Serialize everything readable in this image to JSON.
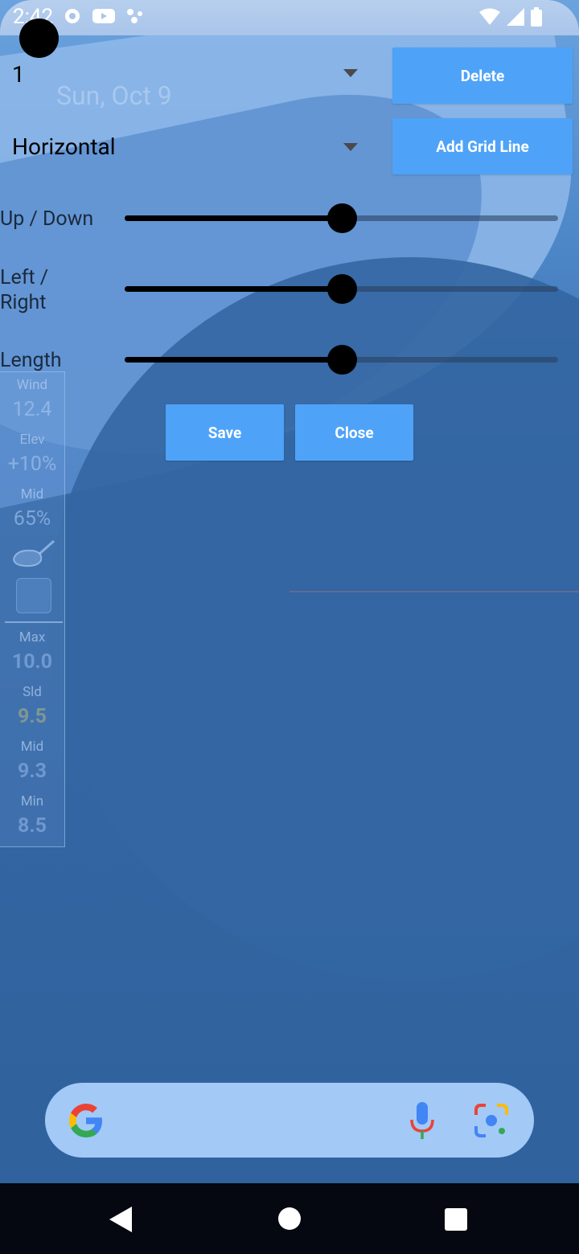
{
  "status_bar": {
    "time": "2:42"
  },
  "background": {
    "date": "Sun, Oct 9"
  },
  "line_select": {
    "value": "1"
  },
  "orientation_select": {
    "value": "Horizontal"
  },
  "buttons": {
    "delete": "Delete",
    "add_grid_line": "Add Grid Line",
    "save": "Save",
    "close": "Close"
  },
  "sliders": [
    {
      "label": "Up / Down",
      "value": 0.5
    },
    {
      "label": "Left / Right",
      "value": 0.5
    },
    {
      "label": "Length",
      "value": 0.5
    }
  ],
  "side_panel": {
    "wind_label": "Wind",
    "wind_value": "12.4",
    "elev_label": "Elev",
    "elev_value": "+10%",
    "mid_label": "Mid",
    "mid_value": "65%",
    "max_label": "Max",
    "max_value": "10.0",
    "sld_label": "Sld",
    "sld_value": "9.5",
    "mid2_label": "Mid",
    "mid2_value": "9.3",
    "min_label": "Min",
    "min_value": "8.5"
  },
  "colors": {
    "button": "#4ea3f8",
    "search_bar": "#a3c9f7"
  }
}
